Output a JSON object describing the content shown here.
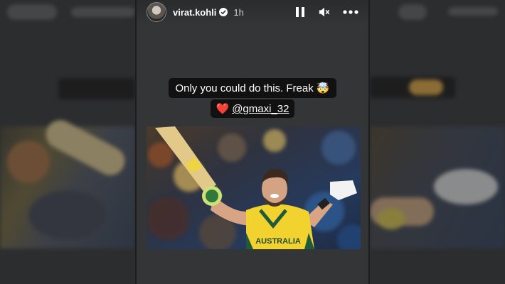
{
  "story": {
    "username": "virat.kohli",
    "time_ago": "1h",
    "caption_line1": "Only you could do this. Freak 🤯",
    "caption_heart": "❤️",
    "caption_mention": "@gmaxi_32",
    "jersey_text": "AUSTRALIA"
  },
  "icons": {
    "verified": "verified-badge-icon",
    "pause": "pause-icon",
    "mute": "speaker-muted-icon",
    "more": "more-options-icon"
  },
  "colors": {
    "background": "#2a2b2d",
    "caption_bg": "#111111",
    "jersey_yellow": "#f2d22e",
    "jersey_green": "#1f5a3a"
  }
}
